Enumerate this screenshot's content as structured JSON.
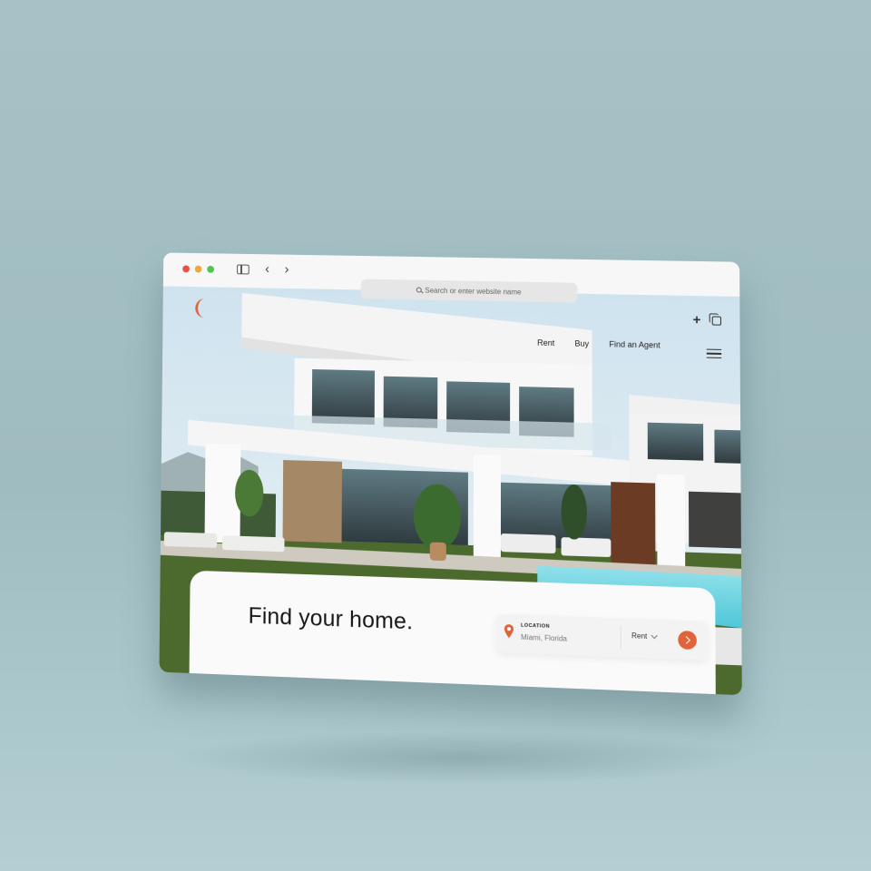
{
  "browser": {
    "address_placeholder": "Search or enter website name",
    "icons": [
      "sidebar-icon",
      "back-icon",
      "forward-icon",
      "new-tab-icon",
      "tabs-icon"
    ]
  },
  "site": {
    "brand_color": "#e1633b",
    "nav": {
      "rent": "Rent",
      "buy": "Buy",
      "find_agent": "Find an Agent"
    },
    "headline": "Find your home.",
    "search": {
      "location_label": "LOCATION",
      "location_value": "Miami, Florida",
      "type_value": "Rent"
    }
  }
}
